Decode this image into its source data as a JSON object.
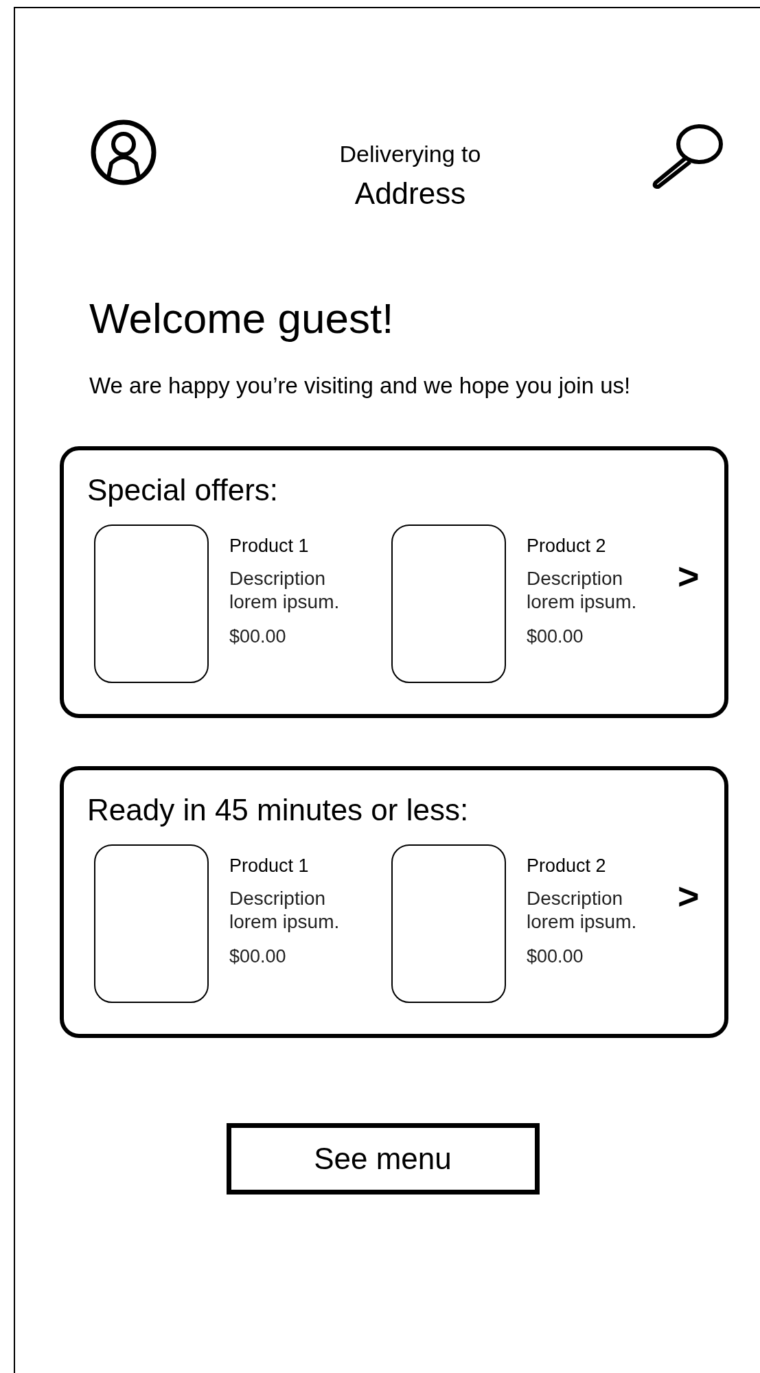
{
  "header": {
    "subtitle": "Deliverying to",
    "address": "Address"
  },
  "welcome": {
    "title": "Welcome guest!",
    "message": "We are happy you’re visiting and we hope you join us!"
  },
  "sections": [
    {
      "title": "Special offers:",
      "next": ">",
      "products": [
        {
          "name": "Product 1",
          "description": "Description lorem ipsum.",
          "price": "$00.00"
        },
        {
          "name": "Product 2",
          "description": "Description lorem ipsum.",
          "price": "$00.00"
        }
      ]
    },
    {
      "title": "Ready in 45 minutes or less:",
      "next": ">",
      "products": [
        {
          "name": "Product 1",
          "description": "Description lorem ipsum.",
          "price": "$00.00"
        },
        {
          "name": "Product 2",
          "description": "Description lorem ipsum.",
          "price": "$00.00"
        }
      ]
    }
  ],
  "button": "See menu"
}
